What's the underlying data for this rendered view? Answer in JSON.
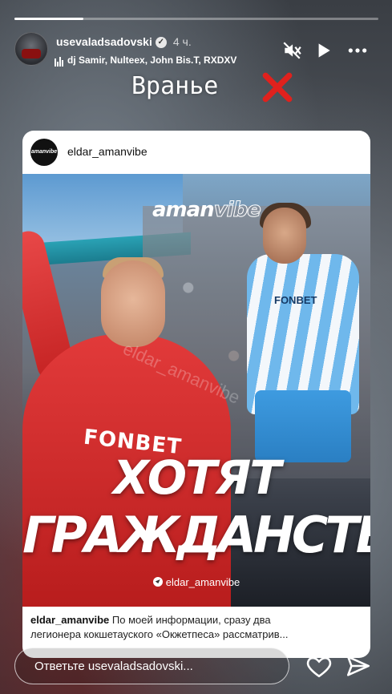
{
  "story": {
    "progress": 0.19
  },
  "header": {
    "username": "usevaladsadovski",
    "time": "4 ч.",
    "music": "dj Samir, Nulteex, John Bis.T, RXDXV"
  },
  "overlay": {
    "text": "Вранье"
  },
  "post": {
    "username": "eldar_amanvibe",
    "avatar_text": "amanvibe",
    "logo_main": "aman",
    "logo_outline": "vibe",
    "headline_1": "ХОТЯТ",
    "headline_2": "ГРАЖДАНСТВО",
    "telegram": "eldar_amanvibe",
    "watermark": "eldar_amanvibe",
    "jersey_text_1": "FONBET",
    "jersey_text_2": "FONBET",
    "caption_user": "eldar_amanvibe",
    "caption_line1": "По моей информации, сразу два",
    "caption_line2": "легионера кокшетауского «Окжетпеса» рассматрив..."
  },
  "footer": {
    "reply_placeholder": "Ответьте usevaladsadovski..."
  },
  "icons": [
    "verified-icon",
    "mute-icon",
    "play-icon",
    "more-icon",
    "cross-icon",
    "heart-icon",
    "send-icon",
    "telegram-icon",
    "music-bars-icon"
  ],
  "colors": {
    "cross": "#e0211d",
    "poster_red": "#d42b2b",
    "poster_blue": "#6fb8ec"
  }
}
